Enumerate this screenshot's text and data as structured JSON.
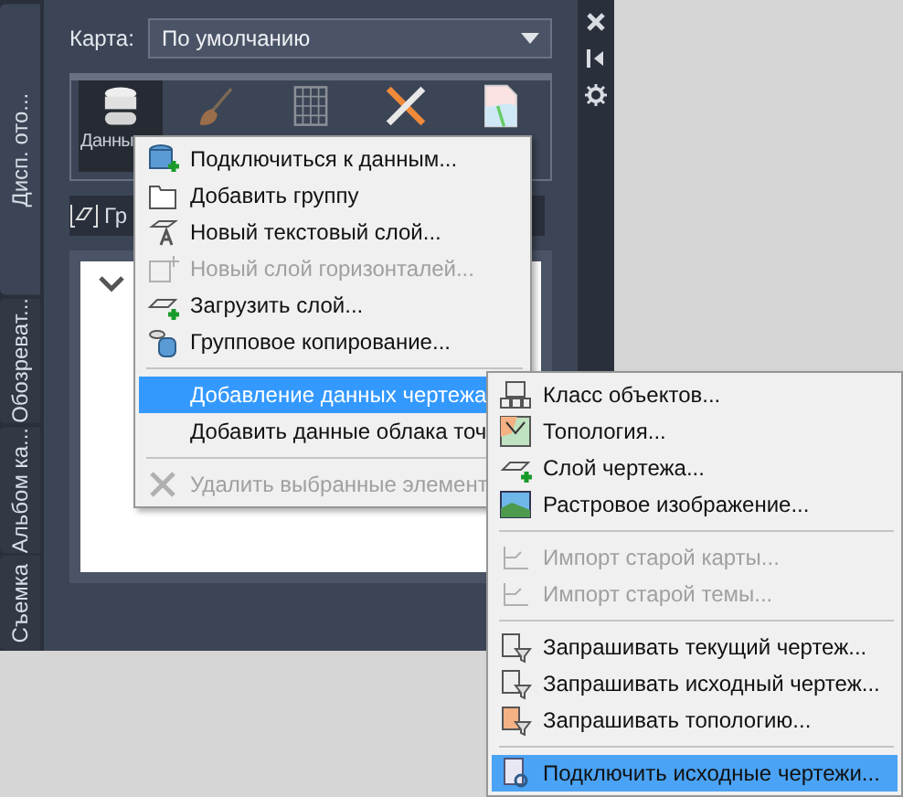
{
  "side_tabs": [
    {
      "label": "Дисп. ото...",
      "selected": true
    },
    {
      "label": "Обозреват...",
      "selected": false
    },
    {
      "label": "Альбом ка...",
      "selected": false
    },
    {
      "label": "Съемка",
      "selected": false
    }
  ],
  "map_field": {
    "label": "Карта:",
    "value": "По умолчанию"
  },
  "toolbar": [
    {
      "label": "Данны",
      "selected": true
    },
    {
      "selected": false
    },
    {
      "selected": false
    },
    {
      "selected": false
    },
    {
      "selected": false
    }
  ],
  "group_button": {
    "label": "Гр"
  },
  "menu": [
    {
      "kind": "item",
      "label": "Подключиться к данным...",
      "disabled": false,
      "selected": false
    },
    {
      "kind": "item",
      "label": "Добавить группу",
      "disabled": false,
      "selected": false
    },
    {
      "kind": "item",
      "label": "Новый текстовый слой...",
      "disabled": false,
      "selected": false
    },
    {
      "kind": "item",
      "label": "Новый слой горизонталей...",
      "disabled": true,
      "selected": false
    },
    {
      "kind": "item",
      "label": "Загрузить слой...",
      "disabled": false,
      "selected": false
    },
    {
      "kind": "item",
      "label": "Групповое копирование...",
      "disabled": false,
      "selected": false
    },
    {
      "kind": "separator"
    },
    {
      "kind": "item",
      "label": "Добавление данных чертежа",
      "disabled": false,
      "selected": true
    },
    {
      "kind": "item",
      "label": "Добавить данные облака точ",
      "disabled": false,
      "selected": false
    },
    {
      "kind": "separator"
    },
    {
      "kind": "item",
      "label": "Удалить выбранные элемент",
      "disabled": true,
      "selected": false
    }
  ],
  "submenu": [
    {
      "kind": "item",
      "label": "Класс объектов...",
      "disabled": false,
      "selected": false
    },
    {
      "kind": "item",
      "label": "Топология...",
      "disabled": false,
      "selected": false
    },
    {
      "kind": "item",
      "label": "Слой чертежа...",
      "disabled": false,
      "selected": false
    },
    {
      "kind": "item",
      "label": "Растровое изображение...",
      "disabled": false,
      "selected": false
    },
    {
      "kind": "separator"
    },
    {
      "kind": "item",
      "label": "Импорт старой карты...",
      "disabled": true,
      "selected": false
    },
    {
      "kind": "item",
      "label": "Импорт старой темы...",
      "disabled": true,
      "selected": false
    },
    {
      "kind": "separator"
    },
    {
      "kind": "item",
      "label": "Запрашивать текущий чертеж...",
      "disabled": false,
      "selected": false
    },
    {
      "kind": "item",
      "label": "Запрашивать исходный чертеж...",
      "disabled": false,
      "selected": false
    },
    {
      "kind": "item",
      "label": "Запрашивать топологию...",
      "disabled": false,
      "selected": false
    },
    {
      "kind": "separator"
    },
    {
      "kind": "item",
      "label": "Подключить исходные чертежи...",
      "disabled": false,
      "selected": true
    }
  ]
}
